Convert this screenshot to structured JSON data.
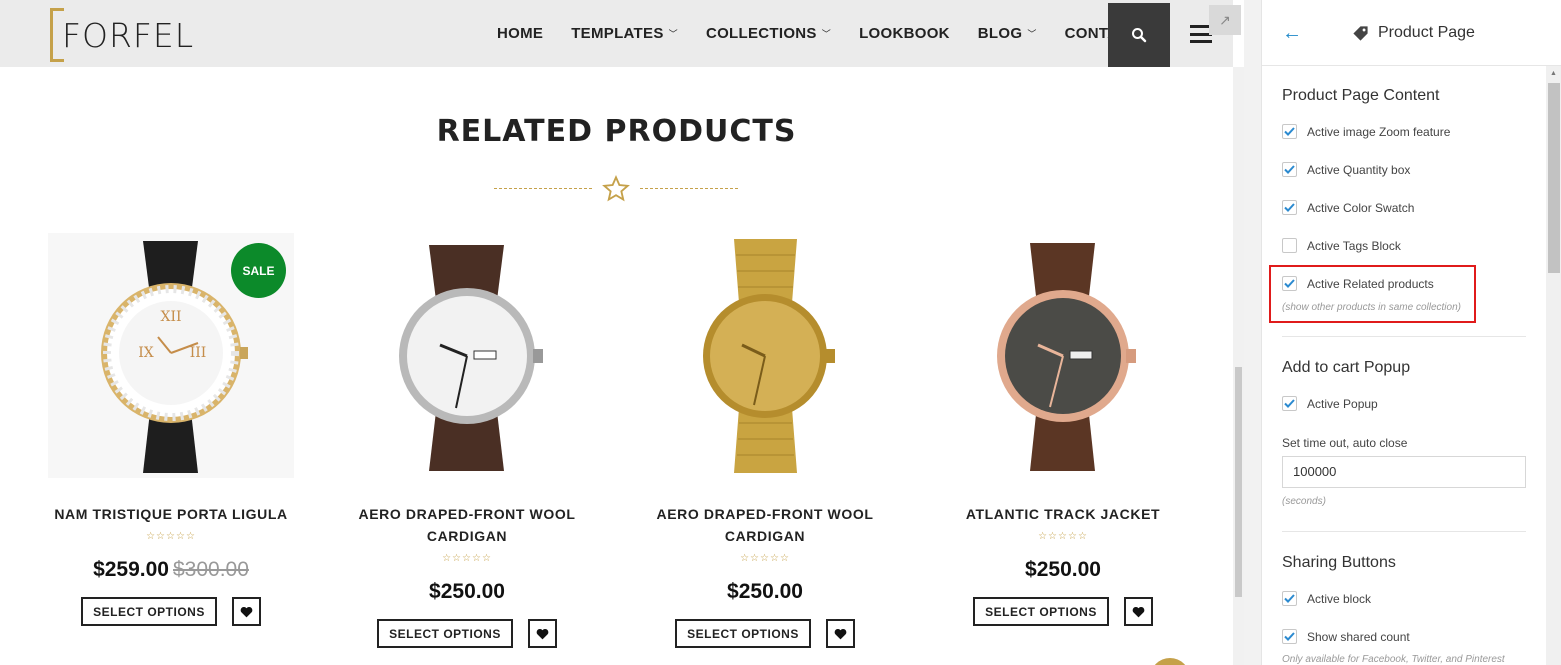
{
  "header": {
    "logo_text": "FORFEL",
    "nav": [
      {
        "label": "HOME",
        "has_dropdown": false
      },
      {
        "label": "TEMPLATES",
        "has_dropdown": true
      },
      {
        "label": "COLLECTIONS",
        "has_dropdown": true
      },
      {
        "label": "LOOKBOOK",
        "has_dropdown": false
      },
      {
        "label": "BLOG",
        "has_dropdown": true
      },
      {
        "label": "CONTACT",
        "has_dropdown": false
      }
    ],
    "search_icon": "search-icon",
    "menu_icon": "hamburger-icon",
    "expand_icon": "expand-arrow-icon"
  },
  "related": {
    "title": "RELATED PRODUCTS",
    "divider_icon": "star-outline-icon",
    "products": [
      {
        "name_line1": "NAM TRISTIQUE PORTA LIGULA",
        "name_line2": "",
        "price": "$259.00",
        "old_price": "$300.00",
        "badge": "SALE",
        "stars": "☆☆☆☆☆",
        "button": "SELECT OPTIONS",
        "watch": "crystal-gold"
      },
      {
        "name_line1": "AERO DRAPED-FRONT WOOL",
        "name_line2": "CARDIGAN",
        "price": "$250.00",
        "old_price": "",
        "badge": "",
        "stars": "☆☆☆☆☆",
        "button": "SELECT OPTIONS",
        "watch": "silver-white"
      },
      {
        "name_line1": "AERO DRAPED-FRONT WOOL",
        "name_line2": "CARDIGAN",
        "price": "$250.00",
        "old_price": "",
        "badge": "",
        "stars": "☆☆☆☆☆",
        "button": "SELECT OPTIONS",
        "watch": "gold-bracelet"
      },
      {
        "name_line1": "ATLANTIC TRACK JACKET",
        "name_line2": "",
        "price": "$250.00",
        "old_price": "",
        "badge": "",
        "stars": "☆☆☆☆☆",
        "button": "SELECT OPTIONS",
        "watch": "rosegold-dark"
      }
    ]
  },
  "panel": {
    "back_icon": "back-arrow-icon",
    "title_icon": "tag-icon",
    "title": "Product Page",
    "sections": {
      "content_title": "Product Page Content",
      "content_options": [
        {
          "label": "Active image Zoom feature",
          "checked": true
        },
        {
          "label": "Active Quantity box",
          "checked": true
        },
        {
          "label": "Active Color Swatch",
          "checked": true
        },
        {
          "label": "Active Tags Block",
          "checked": false
        },
        {
          "label": "Active Related products",
          "checked": true
        }
      ],
      "related_note": "(show other products in same collection)",
      "cart_title": "Add to cart Popup",
      "cart_option": {
        "label": "Active Popup",
        "checked": true
      },
      "timeout_label": "Set time out, auto close",
      "timeout_value": "100000",
      "timeout_unit": "(seconds)",
      "sharing_title": "Sharing Buttons",
      "sharing_options": [
        {
          "label": "Active block",
          "checked": true
        },
        {
          "label": "Show shared count",
          "checked": true
        }
      ],
      "sharing_note": "Only available for Facebook, Twitter, and Pinterest"
    }
  },
  "colors": {
    "accent_gold": "#c5a14a",
    "sale_green": "#0c8a2a",
    "link_blue": "#1e88c9",
    "highlight_red": "#e01b1b"
  }
}
